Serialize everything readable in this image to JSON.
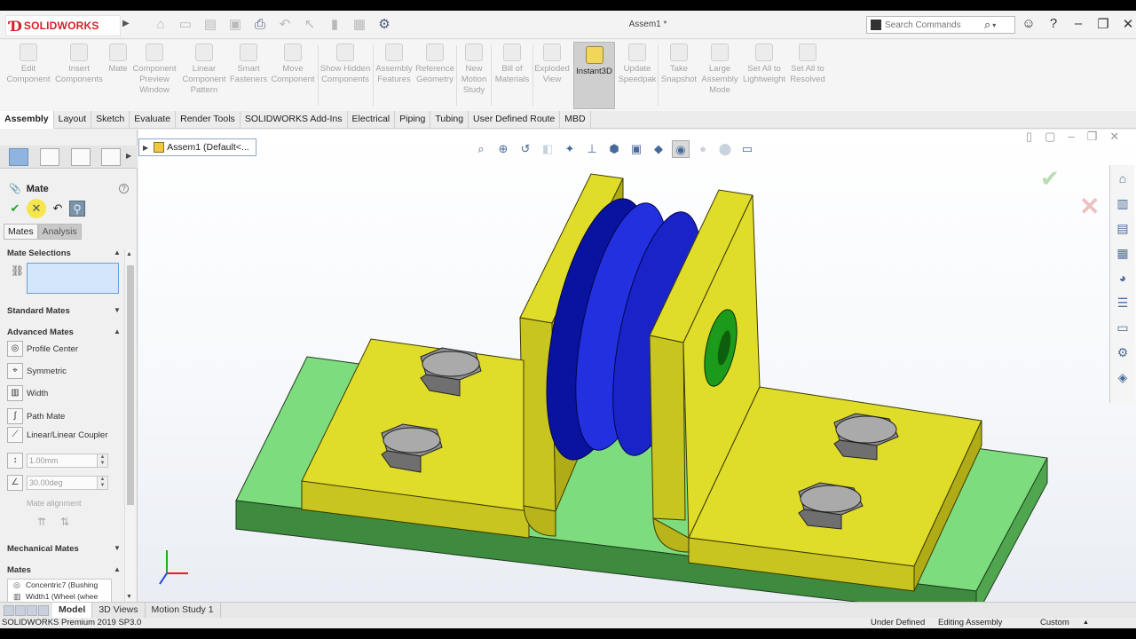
{
  "app": {
    "logo_text": "SOLIDWORKS",
    "document_title": "Assem1 *"
  },
  "search": {
    "placeholder": "Search Commands"
  },
  "ribbon": {
    "buttons": [
      {
        "label": "Edit Component"
      },
      {
        "label": "Insert Components"
      },
      {
        "label": "Mate"
      },
      {
        "label": "Component Preview Window"
      },
      {
        "label": "Linear Component Pattern"
      },
      {
        "label": "Smart Fasteners"
      },
      {
        "label": "Move Component"
      },
      {
        "label": "Show Hidden Components"
      },
      {
        "label": "Assembly Features"
      },
      {
        "label": "Reference Geometry"
      },
      {
        "label": "New Motion Study"
      },
      {
        "label": "Bill of Materials"
      },
      {
        "label": "Exploded View"
      },
      {
        "label": "Instant3D"
      },
      {
        "label": "Update Speedpak"
      },
      {
        "label": "Take Snapshot"
      },
      {
        "label": "Large Assembly Mode"
      },
      {
        "label": "Set All to Lightweight"
      },
      {
        "label": "Set All to Resolved"
      }
    ]
  },
  "command_tabs": [
    "Assembly",
    "Layout",
    "Sketch",
    "Evaluate",
    "Render Tools",
    "SOLIDWORKS Add-Ins",
    "Electrical",
    "Piping",
    "Tubing",
    "User Defined Route",
    "MBD"
  ],
  "property_manager": {
    "title": "Mate",
    "help": "?",
    "subtabs": [
      "Mates",
      "Analysis"
    ],
    "sections": {
      "mate_selections": "Mate Selections",
      "standard_mates": "Standard Mates",
      "advanced_mates": "Advanced Mates",
      "mechanical_mates": "Mechanical Mates",
      "mates": "Mates"
    },
    "advanced_items": [
      "Profile Center",
      "Symmetric",
      "Width",
      "Path Mate",
      "Linear/Linear Coupler"
    ],
    "distance_value": "1.00mm",
    "angle_value": "30.00deg",
    "mate_alignment_label": "Mate alignment",
    "mates_list": [
      "Concentric7 (Bushing",
      "Width1 (Wheel (whee"
    ]
  },
  "tree_flyout": {
    "label": "Assem1  (Default<..."
  },
  "bottom_tabs": [
    "Model",
    "3D Views",
    "Motion Study 1"
  ],
  "status": {
    "version": "SOLIDWORKS Premium 2019 SP3.0",
    "definition": "Under Defined",
    "mode": "Editing Assembly",
    "units": "Custom"
  },
  "colors": {
    "base_plate": "#7ddc7d",
    "bracket": "#e0dc2a",
    "wheel": "#1a23c8",
    "bushing": "#1c9a1c",
    "bolt": "#a8a8a8",
    "logo": "#d2232a"
  }
}
